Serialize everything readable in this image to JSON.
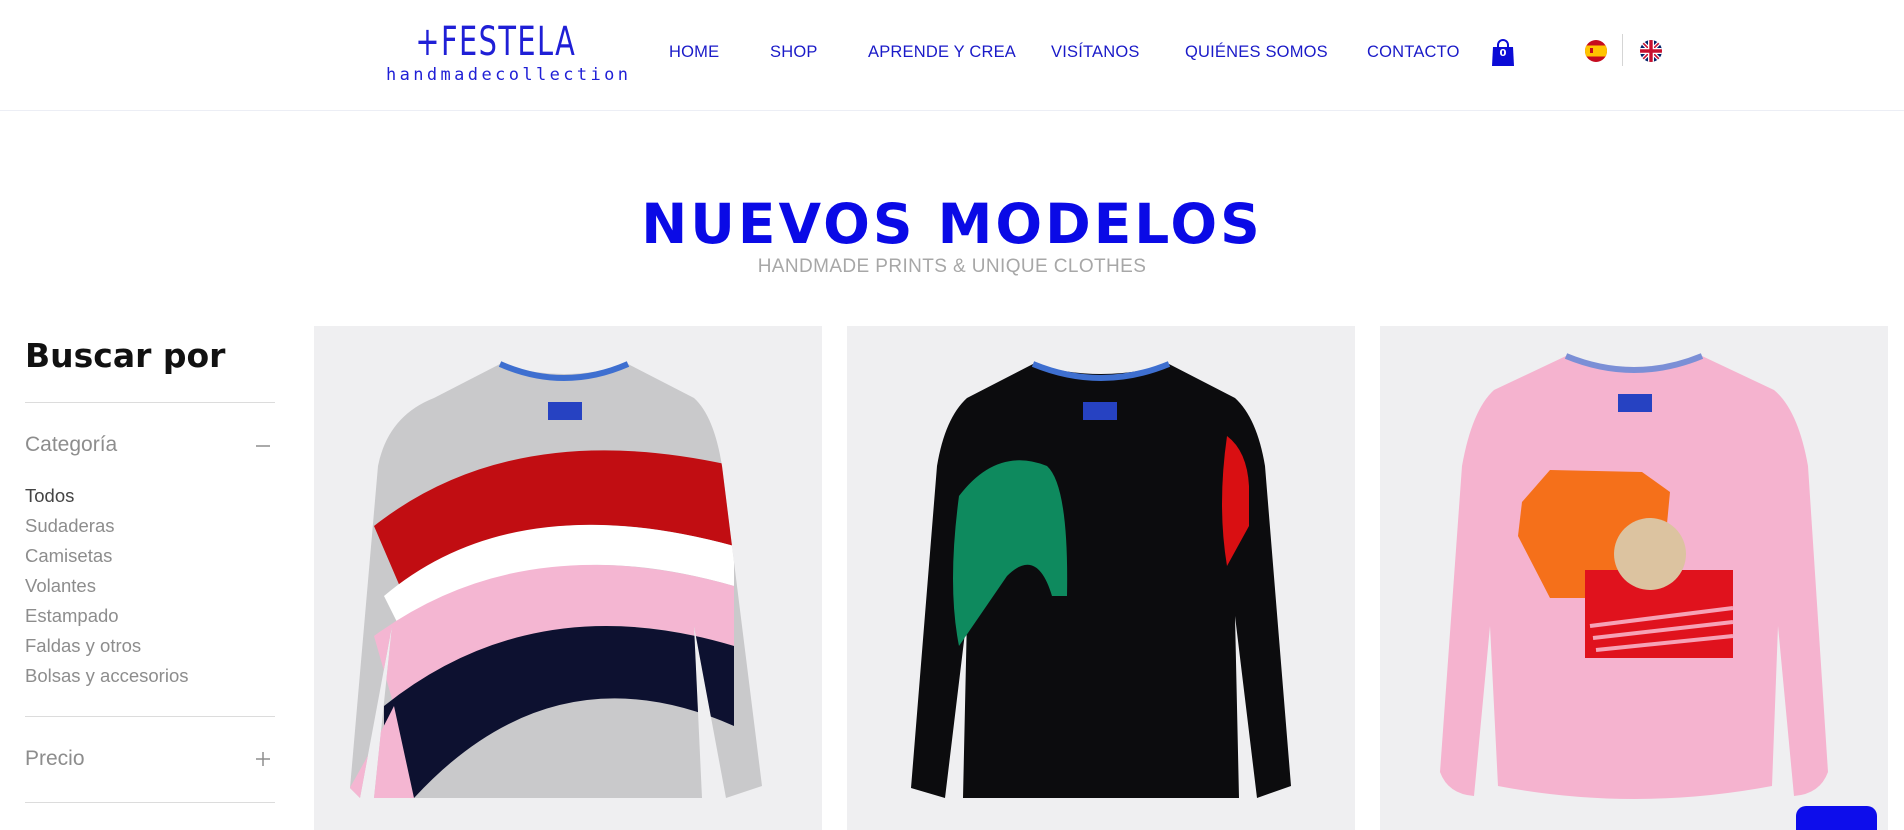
{
  "header": {
    "logo_main": "+FESTELA",
    "logo_sub": "handmadecollection",
    "nav": [
      {
        "label": "HOME",
        "name": "nav-home"
      },
      {
        "label": "SHOP",
        "name": "nav-shop"
      },
      {
        "label": "APRENDE Y CREA",
        "name": "nav-aprende-y-crea"
      },
      {
        "label": "VISÍTANOS",
        "name": "nav-visitanos"
      },
      {
        "label": "QUIÉNES SOMOS",
        "name": "nav-quienes-somos"
      },
      {
        "label": "CONTACTO",
        "name": "nav-contacto"
      }
    ],
    "cart_count": "0",
    "cart_icon": "shopping-bag-icon",
    "languages": [
      {
        "name": "spanish-flag-icon",
        "lang": "es"
      },
      {
        "name": "uk-flag-icon",
        "lang": "en"
      }
    ],
    "accent_color": "#1a1ac8"
  },
  "hero": {
    "title": "NUEVOS MODELOS",
    "subtitle": "HANDMADE PRINTS & UNIQUE CLOTHES",
    "title_color": "#0a0ae6"
  },
  "sidebar": {
    "title": "Buscar por",
    "category_label": "Categoría",
    "category_icon": "minus-icon",
    "categories": [
      "Todos",
      "Sudaderas",
      "Camisetas",
      "Volantes",
      "Estampado",
      "Faldas y otros",
      "Bolsas y accesorios"
    ],
    "selected_category": "Todos",
    "price_label": "Precio",
    "price_icon": "plus-icon"
  },
  "products": [
    {
      "name": "product-grey-striped-sweatshirt",
      "colors": [
        "#c9c9cb",
        "#c10d12",
        "#f4b6d2",
        "#0d1130"
      ]
    },
    {
      "name": "product-black-fringe-sweatshirt",
      "colors": [
        "#0c0c0e",
        "#0e8a5e",
        "#d90f12"
      ]
    },
    {
      "name": "product-pink-geometric-sweatshirt",
      "colors": [
        "#f5b3cf",
        "#f5701a",
        "#dcc3a0",
        "#e0121d"
      ]
    }
  ],
  "chat": {
    "icon": "chat-icon",
    "color": "#0d0deb"
  }
}
